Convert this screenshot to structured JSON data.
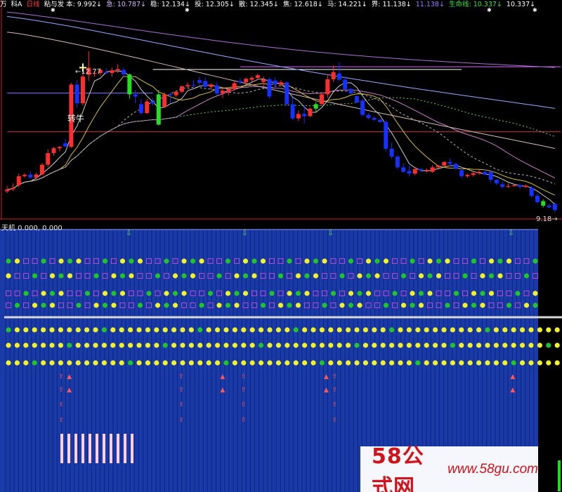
{
  "header": {
    "items": [
      {
        "text": "万",
        "color": "#ffffff"
      },
      {
        "text": "科A",
        "color": "#ffffff"
      },
      {
        "text": "日线",
        "color": "#ff3b3b"
      },
      {
        "text": "粘与发 本: 9.992↓",
        "color": "#ffffff"
      },
      {
        "text": "急: 10.787↓",
        "color": "#d6b8ff"
      },
      {
        "text": "稳: 12.134↓",
        "color": "#ffffff"
      },
      {
        "text": "投: 12.305↓",
        "color": "#ffffff"
      },
      {
        "text": "散: 12.345↓",
        "color": "#ffffff"
      },
      {
        "text": "焦: 12.618↓",
        "color": "#ffffff"
      },
      {
        "text": "马: 14.221↓",
        "color": "#ffffff"
      },
      {
        "text": "界: 11.138↓",
        "color": "#ffffff"
      },
      {
        "text": "11.138↓",
        "color": "#9a7cff"
      },
      {
        "text": "生命线: 10.337↓",
        "color": "#3fe03f"
      },
      {
        "text": "10.337↓",
        "color": "#ffffff"
      }
    ]
  },
  "main": {
    "high_label": "←12.77",
    "low_label": "9.18→",
    "annotation": "转牛"
  },
  "sub": {
    "title": "天机 0.000, 0.000"
  },
  "watermark": {
    "cn": "58公式网",
    "url": "www.58gu.com"
  },
  "colors": {
    "up": "#ff2d2d",
    "down": "#1530ff",
    "bull": "#22e022",
    "sub_bg": "#1a3aa8",
    "dot_yellow": "#f2f22a",
    "dot_green": "#22c22a",
    "square": "#b24ad4"
  },
  "chart_data": {
    "type": "candlestick",
    "price_range": [
      9.0,
      13.7
    ],
    "candles": [
      [
        9.62,
        9.74,
        9.58,
        9.66
      ],
      [
        9.67,
        9.8,
        9.63,
        9.7
      ],
      [
        9.76,
        10.02,
        9.71,
        9.96
      ],
      [
        9.96,
        10.03,
        9.93,
        9.99
      ],
      [
        10.0,
        10.07,
        9.9,
        9.93
      ],
      [
        9.93,
        10.04,
        9.9,
        10.0
      ],
      [
        10.0,
        10.26,
        9.98,
        10.22
      ],
      [
        10.22,
        10.56,
        10.16,
        10.48
      ],
      [
        10.48,
        10.62,
        10.42,
        10.59
      ],
      [
        10.59,
        10.64,
        10.52,
        10.62
      ],
      [
        10.7,
        10.8,
        10.62,
        10.63
      ],
      [
        10.62,
        12.06,
        10.6,
        12.02
      ],
      [
        12.02,
        12.12,
        11.5,
        11.6
      ],
      [
        11.6,
        12.3,
        11.55,
        12.2
      ],
      [
        12.24,
        12.77,
        12.1,
        12.4
      ],
      [
        12.27,
        12.33,
        12.2,
        12.28
      ],
      [
        12.28,
        12.39,
        12.22,
        12.35
      ],
      [
        12.3,
        12.38,
        12.25,
        12.28
      ],
      [
        12.28,
        12.4,
        12.2,
        12.34
      ],
      [
        12.34,
        12.48,
        12.28,
        12.37
      ],
      [
        12.35,
        12.4,
        12.18,
        12.25
      ],
      [
        12.25,
        12.27,
        11.7,
        11.8
      ],
      [
        11.8,
        11.9,
        11.6,
        11.75
      ],
      [
        11.58,
        11.7,
        11.34,
        11.38
      ],
      [
        11.38,
        11.7,
        11.36,
        11.64
      ],
      [
        11.64,
        11.72,
        11.55,
        11.6
      ],
      [
        11.8,
        11.9,
        11.1,
        11.12
      ],
      [
        11.52,
        11.85,
        11.5,
        11.8
      ],
      [
        11.8,
        11.84,
        11.6,
        11.78
      ],
      [
        11.78,
        11.88,
        11.74,
        11.86
      ],
      [
        11.86,
        12.0,
        11.82,
        11.98
      ],
      [
        11.98,
        12.07,
        11.93,
        12.01
      ],
      [
        12.01,
        12.12,
        11.96,
        12.0
      ],
      [
        12.12,
        12.2,
        12.0,
        12.06
      ],
      [
        12.1,
        12.18,
        11.95,
        11.97
      ],
      [
        11.97,
        12.05,
        11.9,
        12.02
      ],
      [
        12.0,
        12.08,
        11.78,
        11.82
      ],
      [
        11.82,
        11.96,
        11.72,
        11.88
      ],
      [
        11.86,
        11.96,
        11.78,
        11.92
      ],
      [
        11.92,
        12.09,
        11.88,
        12.05
      ],
      [
        12.1,
        12.17,
        12.02,
        12.07
      ],
      [
        12.07,
        12.18,
        12.03,
        12.15
      ],
      [
        12.13,
        12.2,
        12.08,
        12.17
      ],
      [
        12.17,
        12.27,
        12.12,
        12.23
      ],
      [
        12.08,
        12.2,
        11.98,
        12.14
      ],
      [
        12.14,
        12.18,
        11.7,
        11.75
      ],
      [
        12.11,
        12.18,
        11.95,
        12.02
      ],
      [
        12.02,
        12.12,
        11.98,
        12.07
      ],
      [
        12.07,
        12.09,
        11.54,
        11.58
      ],
      [
        11.58,
        11.73,
        11.22,
        11.26
      ],
      [
        11.26,
        11.44,
        11.2,
        11.36
      ],
      [
        11.36,
        11.56,
        11.15,
        11.31
      ],
      [
        11.31,
        11.5,
        11.29,
        11.48
      ],
      [
        11.48,
        11.63,
        11.4,
        11.58
      ],
      [
        11.58,
        11.85,
        11.54,
        11.8
      ],
      [
        11.8,
        12.25,
        11.73,
        12.14
      ],
      [
        12.14,
        12.45,
        12.08,
        12.3
      ],
      [
        12.27,
        12.52,
        12.1,
        12.13
      ],
      [
        12.13,
        12.2,
        11.88,
        11.92
      ],
      [
        11.92,
        11.95,
        11.8,
        11.82
      ],
      [
        11.76,
        11.78,
        11.6,
        11.62
      ],
      [
        11.66,
        11.7,
        11.3,
        11.34
      ],
      [
        11.34,
        11.38,
        11.24,
        11.27
      ],
      [
        11.27,
        11.31,
        11.2,
        11.23
      ],
      [
        11.23,
        11.25,
        11.16,
        11.18
      ],
      [
        11.18,
        11.22,
        10.52,
        10.58
      ],
      [
        10.58,
        10.72,
        10.36,
        10.4
      ],
      [
        10.4,
        10.44,
        10.12,
        10.16
      ],
      [
        10.16,
        10.25,
        10.04,
        10.06
      ],
      [
        10.08,
        10.2,
        9.96,
        10.02
      ],
      [
        10.02,
        10.17,
        9.98,
        10.12
      ],
      [
        10.12,
        10.15,
        10.05,
        10.09
      ],
      [
        10.08,
        10.14,
        10.04,
        10.1
      ],
      [
        10.06,
        10.21,
        10.04,
        10.16
      ],
      [
        10.16,
        10.22,
        10.1,
        10.2
      ],
      [
        10.2,
        10.3,
        10.16,
        10.28
      ],
      [
        10.28,
        10.36,
        10.18,
        10.24
      ],
      [
        10.24,
        10.26,
        10.1,
        10.13
      ],
      [
        10.1,
        10.14,
        9.92,
        9.96
      ],
      [
        9.96,
        10.02,
        9.93,
        9.99
      ],
      [
        9.99,
        10.07,
        9.95,
        10.03
      ],
      [
        10.03,
        10.1,
        9.99,
        10.06
      ],
      [
        10.06,
        10.12,
        9.98,
        10.0
      ],
      [
        10.06,
        10.08,
        9.82,
        9.88
      ],
      [
        9.88,
        9.9,
        9.76,
        9.8
      ],
      [
        9.78,
        9.84,
        9.68,
        9.72
      ],
      [
        9.72,
        9.8,
        9.7,
        9.74
      ],
      [
        9.74,
        9.78,
        9.72,
        9.76
      ],
      [
        9.76,
        9.8,
        9.68,
        9.72
      ],
      [
        9.72,
        9.78,
        9.7,
        9.75
      ],
      [
        9.7,
        9.74,
        9.48,
        9.52
      ],
      [
        9.52,
        9.56,
        9.34,
        9.38
      ],
      [
        9.4,
        9.44,
        9.26,
        9.3
      ],
      [
        9.3,
        9.34,
        9.24,
        9.26
      ],
      [
        9.34,
        9.36,
        9.16,
        9.2
      ]
    ],
    "bull_candles": [
      21,
      26,
      53,
      92
    ],
    "markers": [
      {
        "type": "cross",
        "index": 13,
        "price": 12.4
      }
    ],
    "horizontal_lines": [
      {
        "price": 11.83,
        "color": "#7b7bff",
        "from": 0,
        "to": 25
      },
      {
        "price": 12.36,
        "color": "#ffffff",
        "from": 25,
        "to": 78
      },
      {
        "price": 12.42,
        "color": "#dd66ff",
        "from": 40,
        "to": 95
      },
      {
        "price": 10.96,
        "color": "#cc3b3b",
        "from": 0,
        "to": 95
      }
    ],
    "sub_signals": {
      "arrow_columns": [
        28,
        55,
        75,
        117
      ],
      "dot_rows": 4,
      "long_dot_rows": 3,
      "red_up_columns": [
        7,
        9,
        36,
        46,
        51,
        71,
        73,
        116
      ],
      "bar_count": 11
    }
  }
}
